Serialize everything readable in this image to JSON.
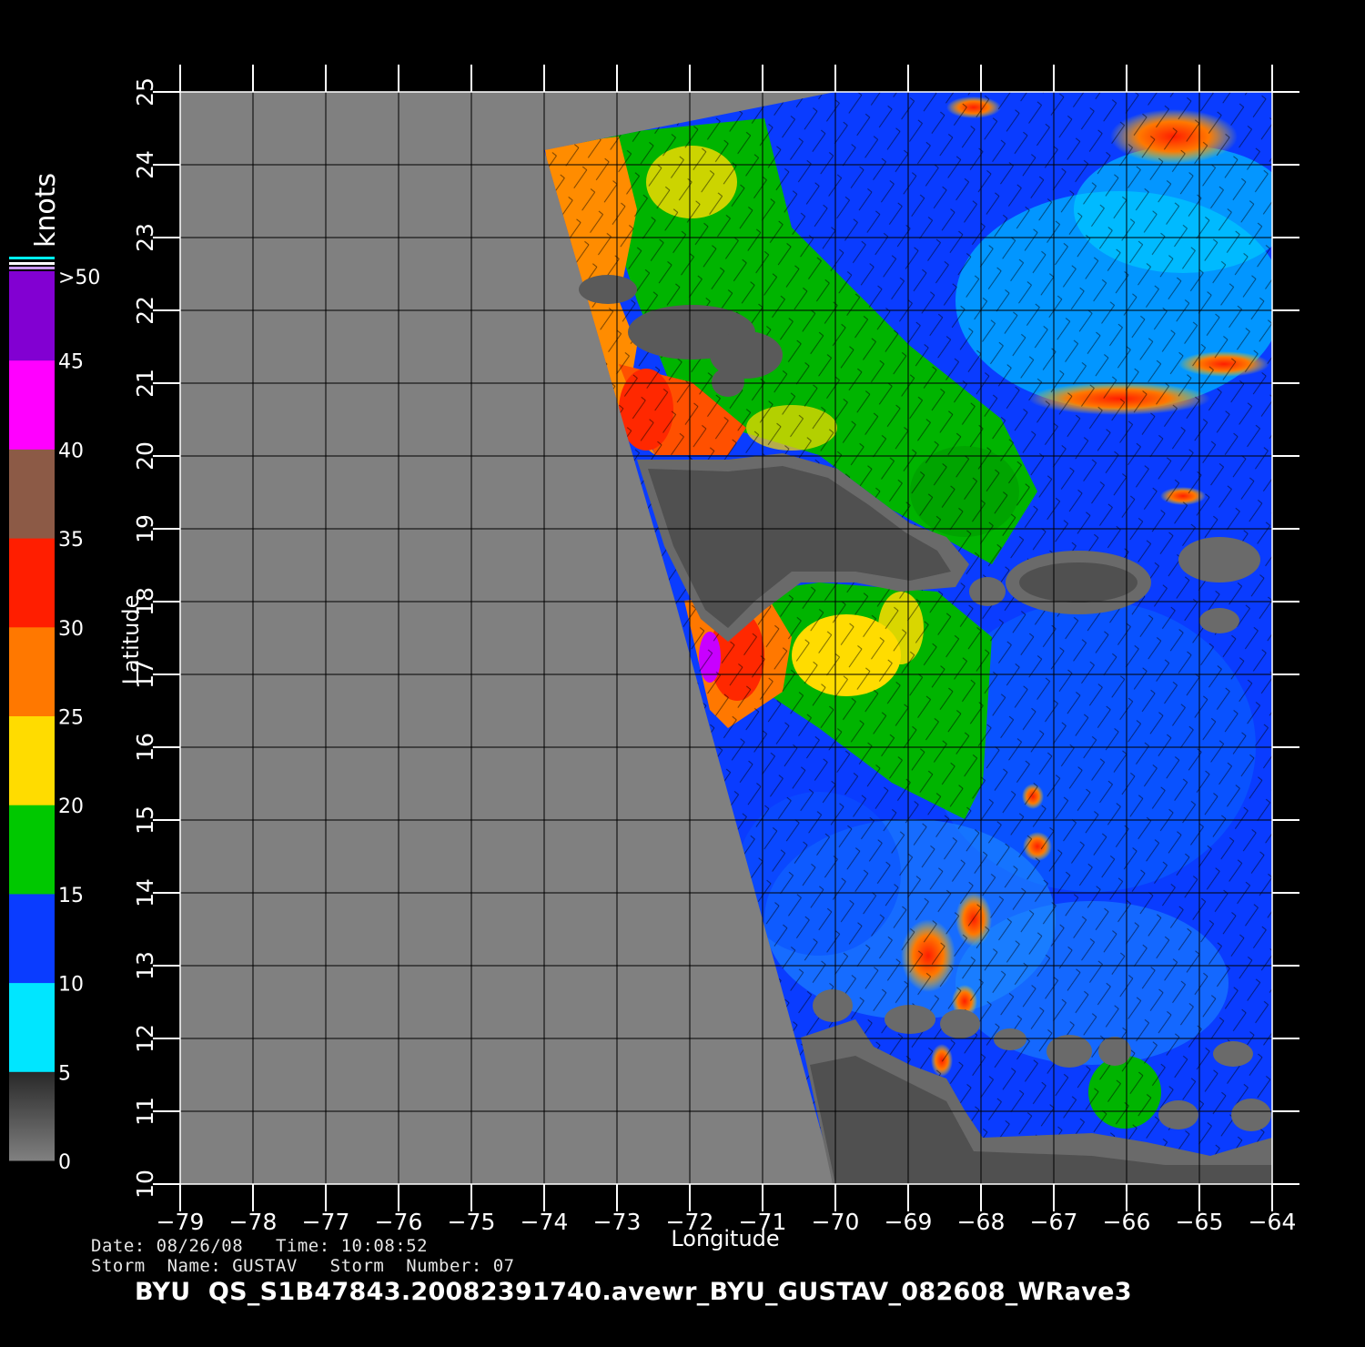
{
  "map": {
    "xlabel": "Longitude",
    "ylabel": "Latitude",
    "lon_range": [
      -79,
      -64
    ],
    "lat_range": [
      10,
      25
    ],
    "lon_ticks": [
      "-79",
      "-78",
      "-77",
      "-76",
      "-75",
      "-74",
      "-73",
      "-72",
      "-71",
      "-70",
      "-69",
      "-68",
      "-67",
      "-66",
      "-65",
      "-64"
    ],
    "lat_ticks": [
      "10",
      "11",
      "12",
      "13",
      "14",
      "15",
      "16",
      "17",
      "18",
      "19",
      "20",
      "21",
      "22",
      "23",
      "24",
      "25"
    ],
    "grid": true,
    "swath_corners_lonlat": [
      [
        -74.0,
        24.2
      ],
      [
        -70.0,
        25.0
      ],
      [
        -64.0,
        25.0
      ],
      [
        -64.0,
        10.0
      ],
      [
        -70.0,
        10.0
      ],
      [
        -72.2,
        18.0
      ]
    ]
  },
  "colorbar": {
    "title": "knots",
    "labels": [
      "0",
      "5",
      "10",
      "15",
      "20",
      "25",
      "30",
      "35",
      "40",
      "45",
      ">50"
    ],
    "colors": {
      "0-5": "#5a5a5a",
      "5-10": "#00e6ff",
      "10-15": "#0a3cff",
      "15-20": "#00c800",
      "20-25": "#ffdc00",
      "25-30": "#ff7800",
      "30-35": "#ff1e00",
      "35-40": "#8c5a46",
      "40-45": "#ff00ff",
      "45-50": "#8200d2"
    }
  },
  "colors": {
    "land": "#505050",
    "no_data": "#808080",
    "background": "#000000"
  },
  "footer": {
    "date_line": "Date: 08/26/08   Time: 10:08:52",
    "storm_line": "Storm  Name: GUSTAV   Storm  Number: 07",
    "file_line": "BYU  QS_S1B47843.20082391740.avewr_BYU_GUSTAV_082608_WRave3"
  }
}
